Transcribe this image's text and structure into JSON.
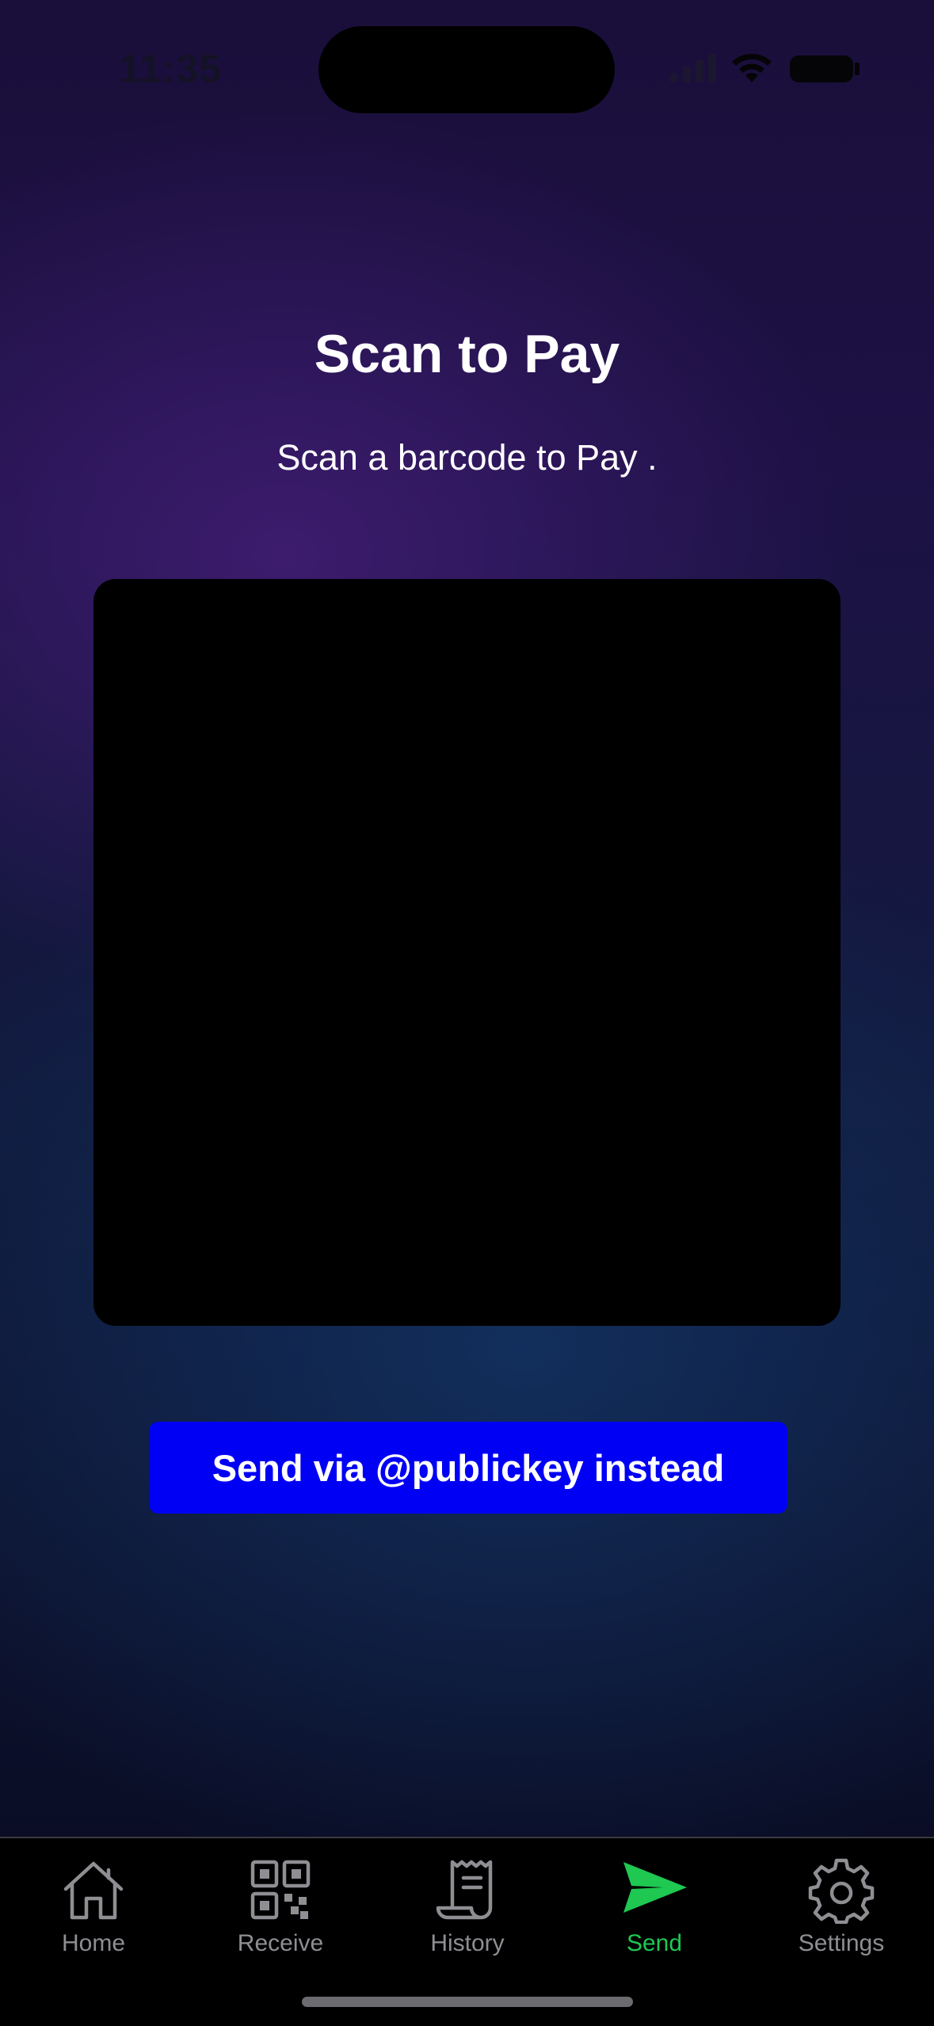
{
  "status_bar": {
    "time": "11:35"
  },
  "scan": {
    "title": "Scan to Pay",
    "subtitle": "Scan a barcode to Pay ."
  },
  "actions": {
    "send_publickey_label": "Send via @publickey instead"
  },
  "tab_bar": {
    "items": [
      {
        "label": "Home",
        "icon": "home-icon"
      },
      {
        "label": "Receive",
        "icon": "qr-code-icon"
      },
      {
        "label": "History",
        "icon": "receipt-icon"
      },
      {
        "label": "Send",
        "icon": "send-icon",
        "active": true
      },
      {
        "label": "Settings",
        "icon": "gear-icon"
      }
    ],
    "active_color": "#1ec851",
    "inactive_color": "#8e8e93"
  },
  "colors": {
    "primary_button": "#0000f5",
    "camera_view": "#000000"
  }
}
